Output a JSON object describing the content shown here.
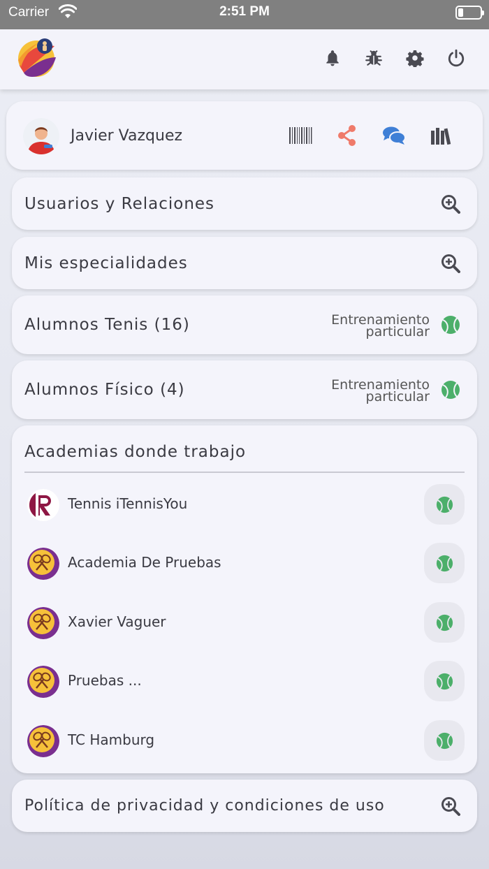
{
  "status_bar": {
    "carrier": "Carrier",
    "time": "2:51 PM"
  },
  "header": {
    "icons": [
      "bell-icon",
      "bug-icon",
      "gear-icon",
      "power-icon"
    ]
  },
  "profile": {
    "name": "Javier Vazquez",
    "actions": [
      "barcode-icon",
      "share-icon",
      "chat-icon",
      "library-icon"
    ],
    "colors": {
      "share": "#ef7a6a",
      "chat": "#3f7fd6"
    }
  },
  "sections": {
    "usuarios": "Usuarios y Relaciones",
    "especialidades": "Mis especialidades",
    "alumnos_tenis": {
      "title": "Alumnos Tenis (16)",
      "tag_line1": "Entrenamiento",
      "tag_line2": "particular"
    },
    "alumnos_fisico": {
      "title": "Alumnos Físico (4)",
      "tag_line1": "Entrenamiento",
      "tag_line2": "particular"
    },
    "academias": {
      "title": "Academias donde trabajo",
      "items": [
        {
          "name": "Tennis iTennisYou"
        },
        {
          "name": "Academia De Pruebas"
        },
        {
          "name": "Xavier Vaguer"
        },
        {
          "name": "Pruebas ..."
        },
        {
          "name": "TC Hamburg"
        }
      ]
    },
    "privacidad": "Política de privacidad y condiciones de uso"
  },
  "colors": {
    "ball_green": "#4caf6a",
    "card_bg": "#f4f4fb"
  }
}
